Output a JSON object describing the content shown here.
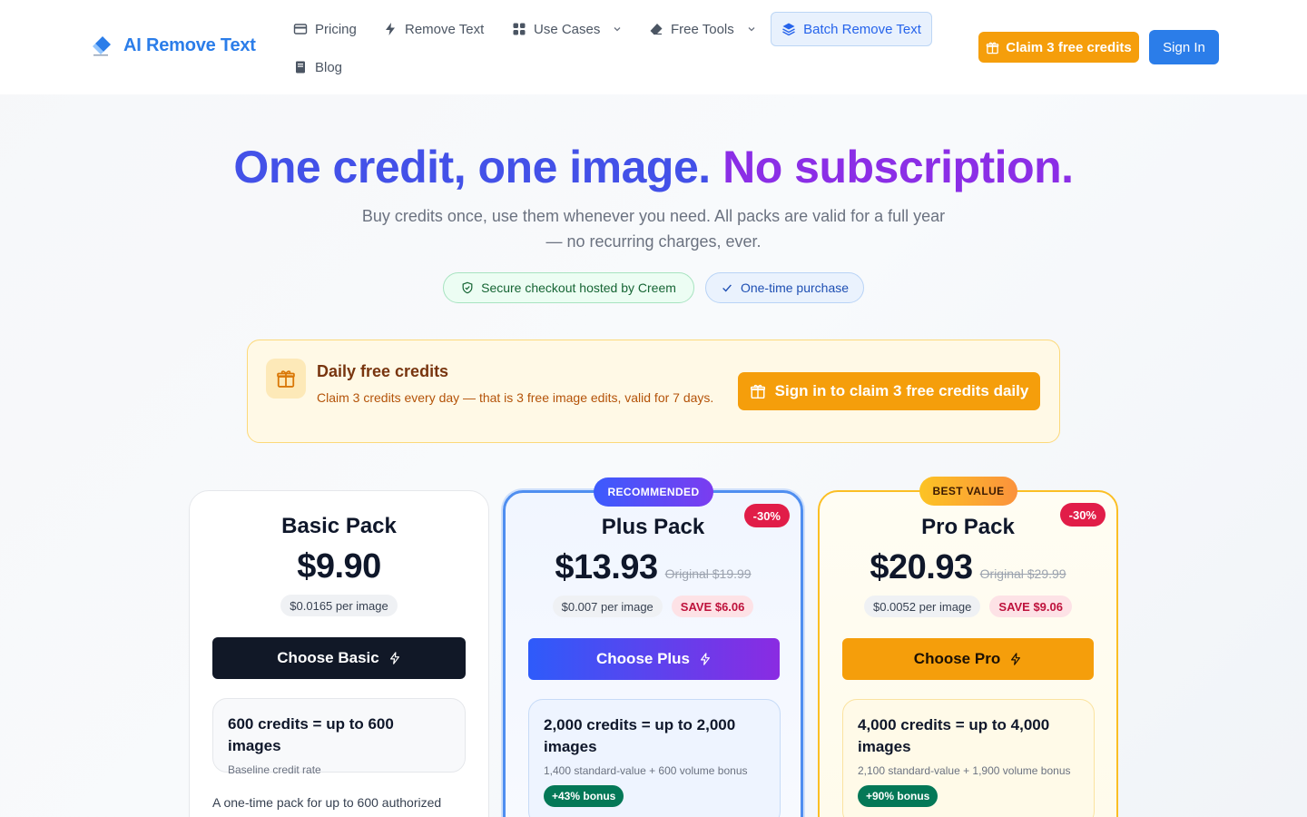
{
  "header": {
    "brand": "AI Remove Text",
    "nav": {
      "pricing": "Pricing",
      "remove_text": "Remove Text",
      "use_cases": "Use Cases",
      "free_tools": "Free Tools",
      "batch": "Batch Remove Text",
      "blog": "Blog"
    },
    "claim_label": "Claim 3 free credits",
    "signin_label": "Sign In",
    "colors": {
      "brand": "#2b7de9",
      "accent": "#f59e0b"
    }
  },
  "hero": {
    "title_part1": "One credit, one image.",
    "title_part2": "No subscription.",
    "subtitle": "Buy credits once, use them whenever you need. All packs are valid for a full year — no recurring charges, ever.",
    "pill_secure": "Secure checkout hosted by Creem",
    "pill_once": "One-time purchase"
  },
  "daily": {
    "title": "Daily free credits",
    "description": "Claim 3 credits every day — that is 3 free image edits, valid for 7 days.",
    "button": "Sign in to claim 3 free credits daily"
  },
  "plans": [
    {
      "name": "Basic Pack",
      "price": "$9.90",
      "rate": "$0.0165 per image",
      "button": "Choose Basic",
      "credits_title": "600 credits = up to 600 images",
      "credits_sub": "Baseline credit rate",
      "description": "A one-time pack for up to 600 authorized"
    },
    {
      "badge": "RECOMMENDED",
      "discount": "-30%",
      "name": "Plus Pack",
      "price": "$13.93",
      "original": "Original $19.99",
      "rate": "$0.007 per image",
      "save": "SAVE $6.06",
      "button": "Choose Plus",
      "credits_title": "2,000 credits = up to 2,000 images",
      "credits_sub": "1,400 standard-value + 600 volume bonus",
      "bonus": "+43% bonus"
    },
    {
      "badge": "BEST VALUE",
      "discount": "-30%",
      "name": "Pro Pack",
      "price": "$20.93",
      "original": "Original $29.99",
      "rate": "$0.0052 per image",
      "save": "SAVE $9.06",
      "button": "Choose Pro",
      "credits_title": "4,000 credits = up to 4,000 images",
      "credits_sub": "2,100 standard-value + 1,900 volume bonus",
      "bonus": "+90% bonus"
    }
  ]
}
